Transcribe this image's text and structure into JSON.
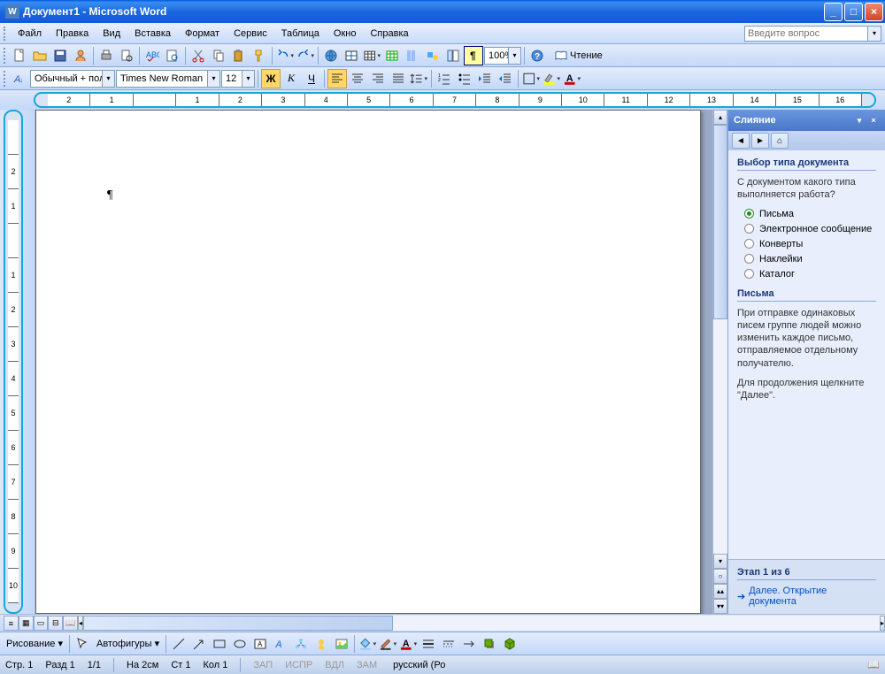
{
  "titlebar": {
    "title": "Документ1 - Microsoft Word",
    "app_icon": "W"
  },
  "menubar": {
    "items": [
      "Файл",
      "Правка",
      "Вид",
      "Вставка",
      "Формат",
      "Сервис",
      "Таблица",
      "Окно",
      "Справка"
    ],
    "help_placeholder": "Введите вопрос"
  },
  "toolbar_std": {
    "zoom": "100%",
    "reading": "Чтение"
  },
  "toolbar_fmt": {
    "style": "Обычный + пол",
    "font": "Times New Roman",
    "size": "12"
  },
  "ruler": {
    "h_labels": [
      "2",
      "1",
      "",
      "1",
      "2",
      "3",
      "4",
      "5",
      "6",
      "7",
      "8",
      "9",
      "10",
      "11",
      "12",
      "13",
      "14",
      "15",
      "16"
    ],
    "v_labels": [
      "",
      "2",
      "1",
      "",
      "1",
      "2",
      "3",
      "4",
      "5",
      "6",
      "7",
      "8",
      "9",
      "10"
    ]
  },
  "taskpane": {
    "title": "Слияние",
    "section1_title": "Выбор типа документа",
    "section1_q": "С документом какого типа выполняется работа?",
    "options": [
      {
        "label": "Письма",
        "selected": true
      },
      {
        "label": "Электронное сообщение",
        "selected": false
      },
      {
        "label": "Конверты",
        "selected": false
      },
      {
        "label": "Наклейки",
        "selected": false
      },
      {
        "label": "Каталог",
        "selected": false
      }
    ],
    "section2_title": "Письма",
    "section2_text": "При отправке одинаковых писем группе людей можно изменить каждое письмо, отправляемое отдельному получателю.",
    "section2_hint": "Для продолжения щелкните \"Далее\".",
    "step": "Этап 1 из 6",
    "next_link": "Далее. Открытие документа"
  },
  "drawbar": {
    "draw_label": "Рисование",
    "autoshapes": "Автофигуры"
  },
  "statusbar": {
    "page": "Стр. 1",
    "section": "Разд 1",
    "pages": "1/1",
    "at": "На 2см",
    "line": "Ст 1",
    "col": "Кол 1",
    "rec": "ЗАП",
    "trk": "ИСПР",
    "ext": "ВДЛ",
    "ovr": "ЗАМ",
    "lang": "русский (Ро"
  }
}
